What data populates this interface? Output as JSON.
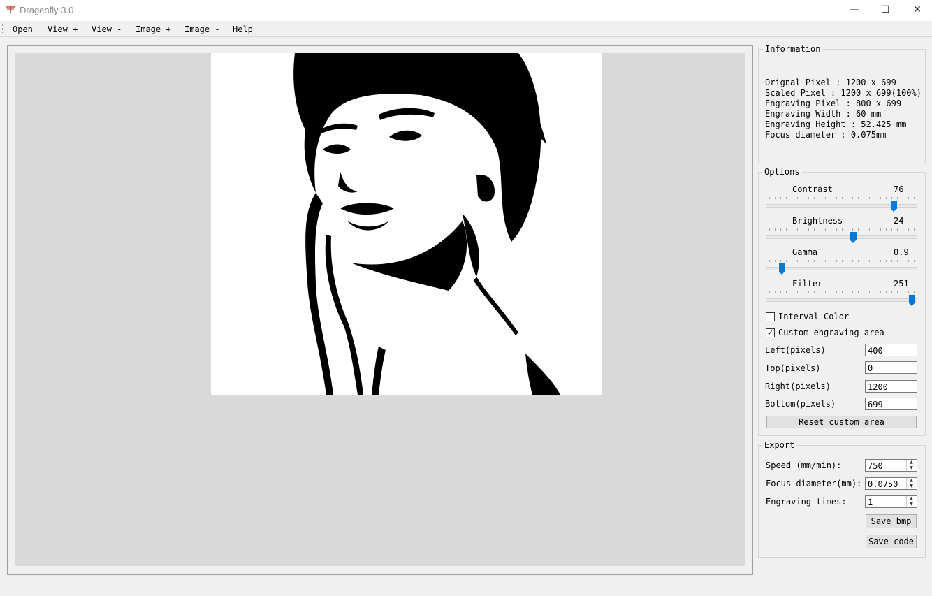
{
  "window": {
    "title": "Dragenfly 3.0",
    "minimize_glyph": "—",
    "maximize_glyph": "☐",
    "close_glyph": "✕"
  },
  "menu": {
    "items": [
      "Open",
      "View +",
      "View -",
      "Image +",
      "Image -",
      "Help"
    ]
  },
  "info": {
    "title": "Information",
    "lines": [
      "Orignal Pixel : 1200 x 699",
      "Scaled Pixel : 1200 x 699(100%)",
      "Engraving Pixel : 800 x 699",
      "Engraving Width : 60 mm",
      "Engraving Height : 52.425 mm",
      "Focus diameter : 0.075mm"
    ]
  },
  "options": {
    "title": "Options",
    "sliders": [
      {
        "label": "Contrast",
        "value": "76",
        "fraction": 0.86
      },
      {
        "label": "Brightness",
        "value": "24",
        "fraction": 0.58
      },
      {
        "label": "Gamma",
        "value": "0.9",
        "fraction": 0.09
      },
      {
        "label": "Filter",
        "value": "251",
        "fraction": 0.985
      }
    ],
    "interval_color": {
      "label": "Interval Color",
      "checked": false
    },
    "custom_area": {
      "label": "Custom engraving area",
      "checked": true,
      "check_glyph": "✓"
    },
    "fields": [
      {
        "label": "Left(pixels)",
        "value": "400"
      },
      {
        "label": "Top(pixels)",
        "value": "0"
      },
      {
        "label": "Right(pixels)",
        "value": "1200"
      },
      {
        "label": "Bottom(pixels)",
        "value": "699"
      }
    ],
    "reset_button": "Reset custom area"
  },
  "export": {
    "title": "Export",
    "spinners": [
      {
        "label": "Speed (mm/min):",
        "value": "750"
      },
      {
        "label": "Focus diameter(mm):",
        "value": "0.0750"
      },
      {
        "label": "Engraving times:",
        "value": "1"
      }
    ],
    "save_bmp": "Save bmp",
    "save_code": "Save code",
    "spin_up_glyph": "▲",
    "spin_down_glyph": "▼"
  },
  "colors": {
    "accent": "#0078d7",
    "canvas_bg": "#d9d9d9",
    "window_bg": "#f0f0f0"
  }
}
